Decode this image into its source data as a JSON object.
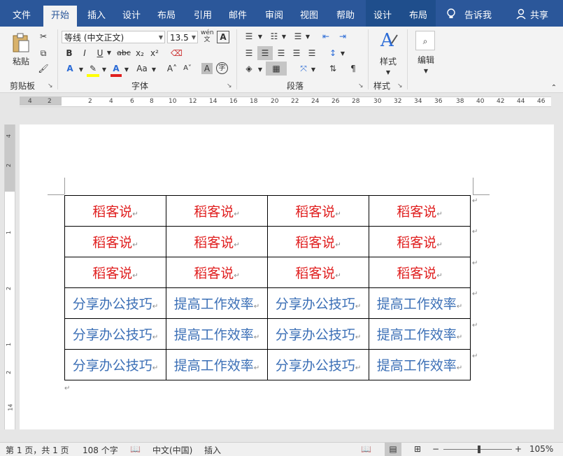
{
  "tabs": [
    "文件",
    "开始",
    "插入",
    "设计",
    "布局",
    "引用",
    "邮件",
    "审阅",
    "视图",
    "帮助",
    "设计",
    "布局"
  ],
  "active_tab": "开始",
  "tell_me": "告诉我",
  "share": "共享",
  "clipboard": {
    "paste": "粘贴",
    "label": "剪贴板"
  },
  "font": {
    "name": "等线 (中文正文)",
    "size": "13.5",
    "label": "字体",
    "bold": "B",
    "italic": "I",
    "underline": "U",
    "strike": "abc",
    "sub": "x₂",
    "sup": "x²",
    "phonetic": "wén\n文",
    "charbox": "A",
    "grow": "A˄",
    "shrink": "A˅",
    "case": "Aa",
    "shade": "A",
    "circle": "字"
  },
  "paragraph": {
    "label": "段落"
  },
  "styles": {
    "btn": "样式",
    "label": "样式"
  },
  "editing": {
    "btn": "编辑"
  },
  "ruler_numbers": [
    "4",
    "2",
    "2",
    "4",
    "6",
    "8",
    "10",
    "12",
    "14",
    "16",
    "18",
    "20",
    "22",
    "24",
    "26",
    "28",
    "30",
    "32",
    "34",
    "36",
    "38",
    "40",
    "42",
    "44",
    "46"
  ],
  "vruler_numbers": [
    "4",
    "2",
    "1",
    "2",
    "1",
    "2",
    "14"
  ],
  "table": {
    "rows": [
      [
        "稻客说",
        "稻客说",
        "稻客说",
        "稻客说"
      ],
      [
        "稻客说",
        "稻客说",
        "稻客说",
        "稻客说"
      ],
      [
        "稻客说",
        "稻客说",
        "稻客说",
        "稻客说"
      ],
      [
        "分享办公技巧",
        "提高工作效率",
        "分享办公技巧",
        "提高工作效率"
      ],
      [
        "分享办公技巧",
        "提高工作效率",
        "分享办公技巧",
        "提高工作效率"
      ],
      [
        "分享办公技巧",
        "提高工作效率",
        "分享办公技巧",
        "提高工作效率"
      ]
    ],
    "red_color": "#e02020",
    "blue_color": "#3b6fb6"
  },
  "paragraph_mark": "↵",
  "status": {
    "page": "第 1 页，共 1 页",
    "words": "108 个字",
    "language": "中文(中国)",
    "mode": "插入",
    "zoom": "105%"
  },
  "colors": {
    "ribbon_blue": "#2b579a"
  }
}
